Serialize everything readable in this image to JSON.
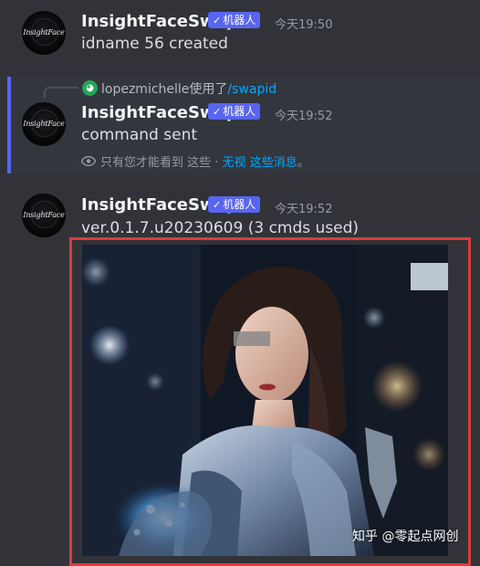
{
  "bot": {
    "name": "InsightFaceSwap",
    "badge": "机器人",
    "avatar_text": "InsightFace"
  },
  "messages": [
    {
      "time": "今天19:50",
      "text": "idname 56 created"
    },
    {
      "time": "今天19:52",
      "text": "command sent"
    },
    {
      "time": "今天19:52",
      "text": "ver.0.1.7.u20230609 (3 cmds used)"
    }
  ],
  "reply": {
    "user": "lopezmichelle",
    "action": "使用了",
    "command": "/swapid"
  },
  "ephemeral": {
    "prefix": "只有您才能看到 这些 · ",
    "dismiss": "无视",
    "suffix_link": "这些消息",
    "period": "。"
  },
  "watermark": "知乎 @零起点网创",
  "colors": {
    "accent": "#5865f2",
    "link": "#00a8fc",
    "highlight": "#e03a3a",
    "background": "#313338"
  },
  "icons": [
    "discord-icon",
    "eye-icon",
    "checkmark-icon"
  ]
}
